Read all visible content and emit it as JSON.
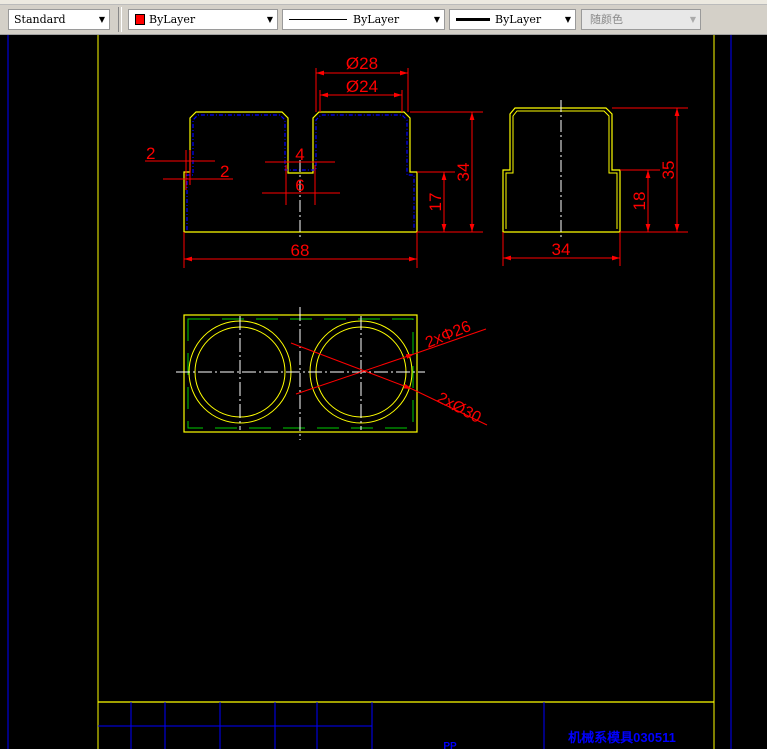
{
  "toolbar": {
    "text_style": "Standard",
    "layer_color": "ByLayer",
    "linetype": "ByLayer",
    "lineweight": "ByLayer",
    "plot_style": "随颜色",
    "color_swatch": "#ff0000"
  },
  "drawing": {
    "front_view": {
      "dim_d28": "Ø28",
      "dim_d24": "Ø24",
      "dim_2a": "2",
      "dim_2b": "2",
      "dim_4": "4",
      "dim_6": "6",
      "dim_17": "17",
      "dim_34": "34",
      "dim_68": "68"
    },
    "side_view": {
      "dim_35": "35",
      "dim_18": "18",
      "dim_34": "34"
    },
    "top_view": {
      "dim_2x26": "2xΦ26",
      "dim_2x30": "2xØ30"
    },
    "title_block": {
      "school": "机械系模具030511",
      "material": "PP"
    }
  },
  "colors": {
    "outline": "#ffff00",
    "dimension": "#ff0000",
    "center": "#ffffff",
    "hidden": "#0000ff",
    "frame_blue": "#0000ff",
    "inner": "#00cc00"
  }
}
